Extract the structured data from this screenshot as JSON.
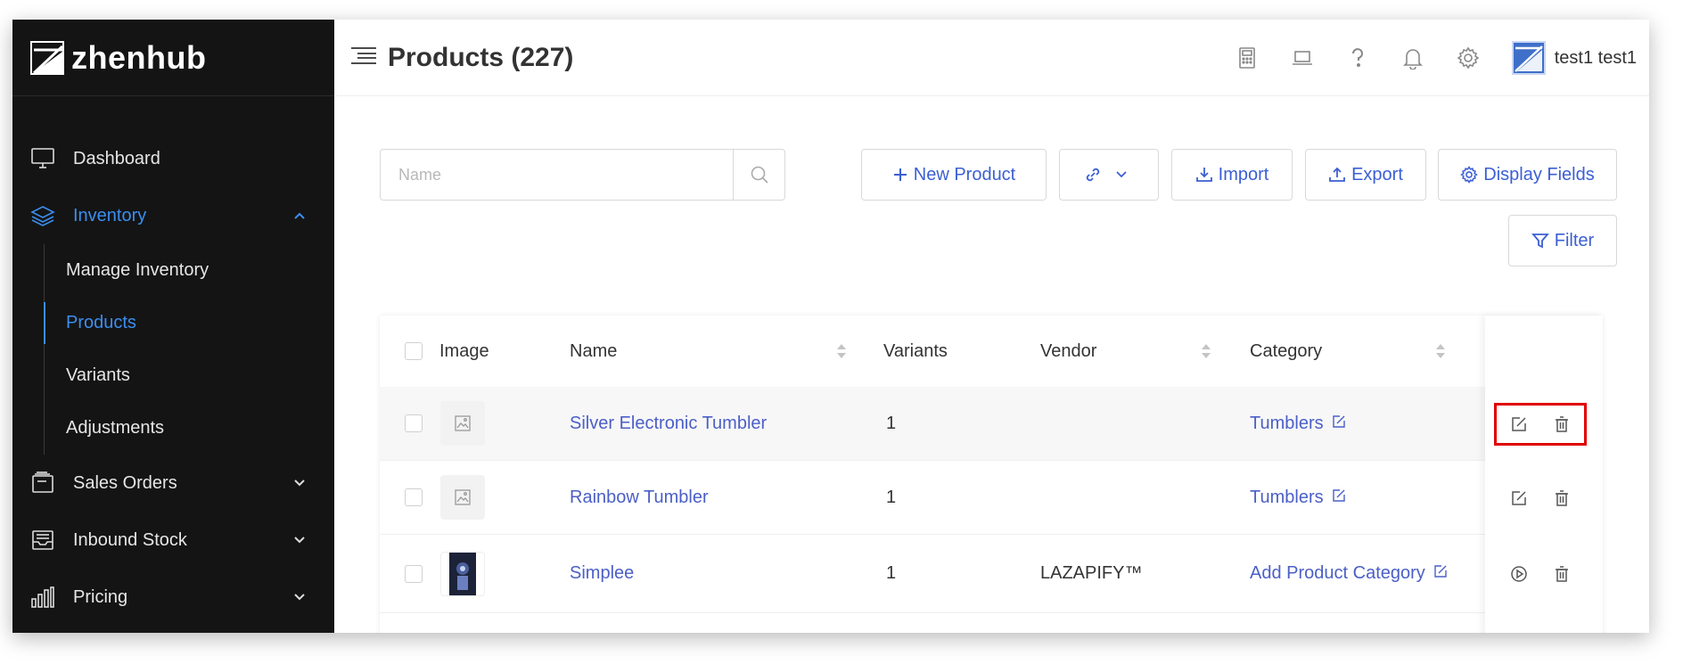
{
  "app": {
    "brand": "zhenhub"
  },
  "sidebar": {
    "items": [
      {
        "label": "Dashboard",
        "icon": "monitor-icon"
      },
      {
        "label": "Inventory",
        "icon": "layers-icon",
        "active": true,
        "expanded": true
      },
      {
        "label": "Sales Orders",
        "icon": "orders-icon"
      },
      {
        "label": "Inbound Stock",
        "icon": "inbox-icon"
      },
      {
        "label": "Pricing",
        "icon": "bar-chart-icon"
      }
    ],
    "inventory_sub": [
      {
        "label": "Manage Inventory"
      },
      {
        "label": "Products",
        "active": true
      },
      {
        "label": "Variants"
      },
      {
        "label": "Adjustments"
      }
    ]
  },
  "header": {
    "title": "Products (227)",
    "user": "test1 test1",
    "icons": [
      "calculator-icon",
      "laptop-icon",
      "help-icon",
      "bell-icon",
      "gear-icon"
    ]
  },
  "toolbar": {
    "search_placeholder": "Name",
    "new_product": "New Product",
    "import": "Import",
    "export": "Export",
    "display_fields": "Display Fields",
    "filter": "Filter"
  },
  "table": {
    "columns": [
      "Image",
      "Name",
      "Variants",
      "Vendor",
      "Category"
    ],
    "rows": [
      {
        "name": "Silver Electronic Tumbler",
        "variants": "1",
        "vendor": "",
        "category": "Tumblers",
        "image": "placeholder"
      },
      {
        "name": "Rainbow Tumbler",
        "variants": "1",
        "vendor": "",
        "category": "Tumblers",
        "image": "placeholder"
      },
      {
        "name": "Simplee",
        "variants": "1",
        "vendor": "LAZAPIFY™",
        "category": "Add Product Category",
        "image": "photo"
      }
    ]
  },
  "colors": {
    "accent": "#3b8ef0",
    "link": "#4b5fc7",
    "sidebar_bg": "#141414",
    "highlight": "#e00000"
  }
}
